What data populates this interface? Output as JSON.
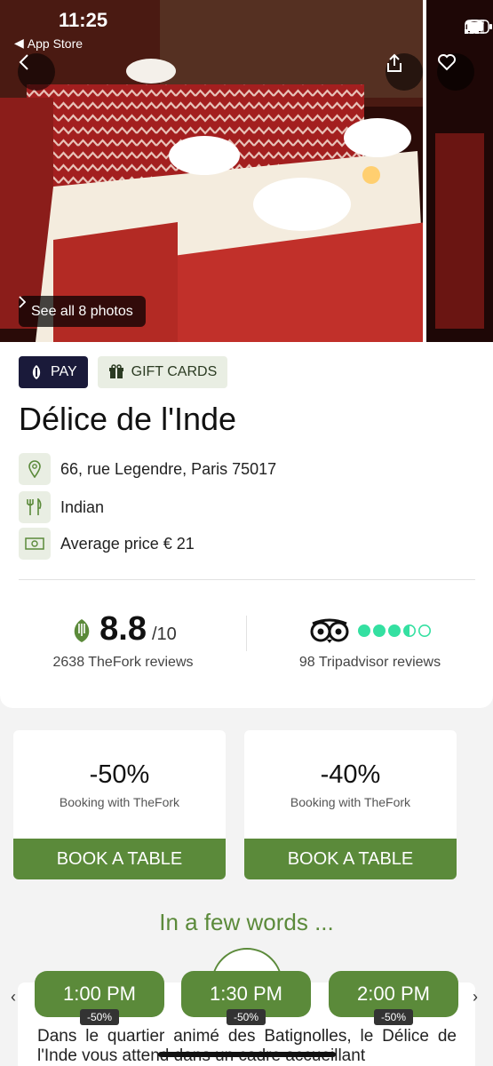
{
  "status": {
    "time": "11:25",
    "back_app": "App Store"
  },
  "hero": {
    "photos_label": "See all 8 photos"
  },
  "chips": {
    "pay": "PAY",
    "gift": "GIFT CARDS"
  },
  "restaurant": {
    "name": "Délice de l'Inde",
    "address": "66, rue Legendre, Paris 75017",
    "cuisine": "Indian",
    "price": "Average price € 21"
  },
  "ratings": {
    "thefork_score": "8.8",
    "thefork_max": "/10",
    "thefork_reviews": "2638 TheFork reviews",
    "tripadvisor_bubbles": 3.5,
    "tripadvisor_reviews": "98 Tripadvisor reviews"
  },
  "offers": [
    {
      "discount": "-50%",
      "label": "Booking with TheFork",
      "button": "BOOK A TABLE"
    },
    {
      "discount": "-40%",
      "label": "Booking with TheFork",
      "button": "BOOK A TABLE"
    }
  ],
  "about": {
    "heading": "In a few words ...",
    "text": "Dans le quartier animé des Batignolles, le Délice de l'Inde vous attend dans un cadre accueillant"
  },
  "slots": [
    {
      "time": "1:00 PM",
      "badge": "-50%"
    },
    {
      "time": "1:30 PM",
      "badge": "-50%"
    },
    {
      "time": "2:00 PM",
      "badge": "-50%"
    }
  ],
  "colors": {
    "brand_green": "#5b8a3a",
    "pay_chip": "#1a1a3a",
    "tripadvisor_green": "#34e0a1"
  }
}
